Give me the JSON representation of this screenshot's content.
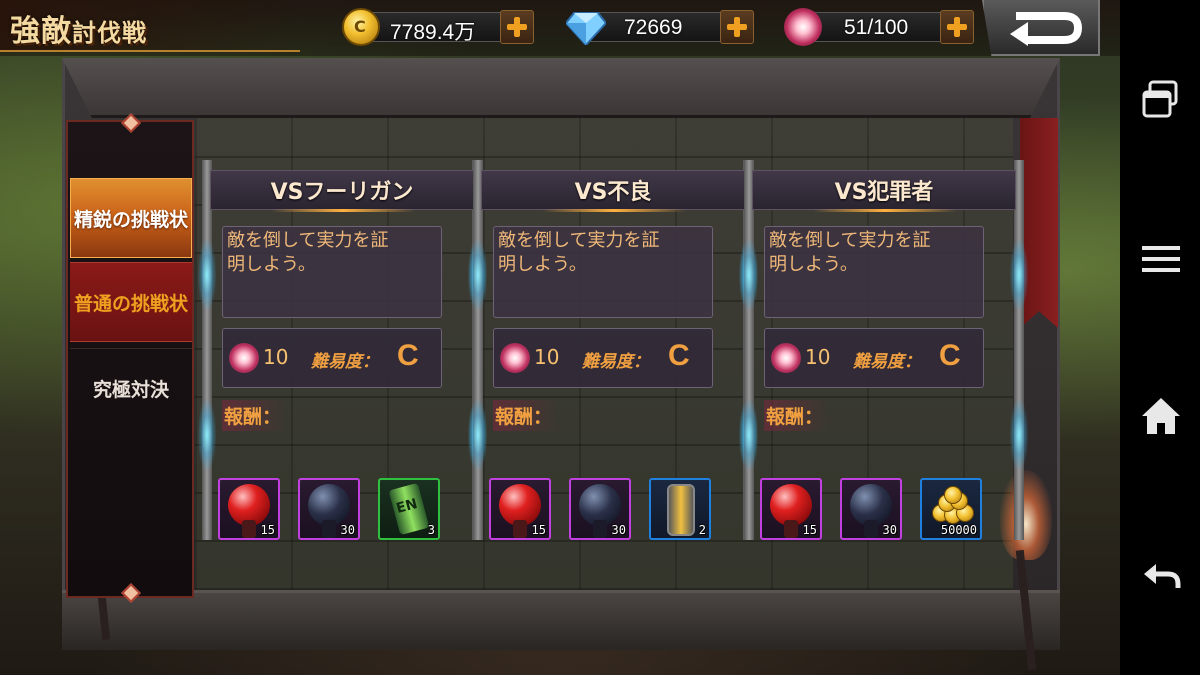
{
  "header": {
    "title_main": "強敵",
    "title_sub": "討伐戦"
  },
  "resources": {
    "coins": {
      "value": "7789.4万",
      "icon": "gold-coin-icon"
    },
    "gems": {
      "value": "72669",
      "icon": "diamond-icon"
    },
    "energy": {
      "value": "51/100",
      "icon": "energy-orb-icon"
    }
  },
  "tabs": [
    {
      "label": "精鋭の挑戦状",
      "state": "active"
    },
    {
      "label": "普通の挑戦状",
      "state": "normal"
    },
    {
      "label": "究極対決",
      "state": "normal"
    }
  ],
  "cards": [
    {
      "title": "VSフーリガン",
      "desc_line1": "敵を倒して実力を証",
      "desc_line2": "明しよう。",
      "cost": "10",
      "difficulty_label": "難易度：",
      "difficulty": "C",
      "reward_label": "報酬：",
      "rewards": [
        {
          "type": "red-orb",
          "qty": "15",
          "rarity": "purple"
        },
        {
          "type": "dark-orb",
          "qty": "30",
          "rarity": "purple"
        },
        {
          "type": "energy-drink",
          "qty": "3",
          "rarity": "green"
        }
      ]
    },
    {
      "title": "VS不良",
      "desc_line1": "敵を倒して実力を証",
      "desc_line2": "明しよう。",
      "cost": "10",
      "difficulty_label": "難易度：",
      "difficulty": "C",
      "reward_label": "報酬：",
      "rewards": [
        {
          "type": "red-orb",
          "qty": "15",
          "rarity": "purple"
        },
        {
          "type": "dark-orb",
          "qty": "30",
          "rarity": "purple"
        },
        {
          "type": "lantern",
          "qty": "2",
          "rarity": "blue"
        }
      ]
    },
    {
      "title": "VS犯罪者",
      "desc_line1": "敵を倒して実力を証",
      "desc_line2": "明しよう。",
      "cost": "10",
      "difficulty_label": "難易度：",
      "difficulty": "C",
      "reward_label": "報酬：",
      "rewards": [
        {
          "type": "red-orb",
          "qty": "15",
          "rarity": "purple"
        },
        {
          "type": "dark-orb",
          "qty": "30",
          "rarity": "purple"
        },
        {
          "type": "gold-coins",
          "qty": "50000",
          "rarity": "blue"
        }
      ]
    }
  ],
  "system_nav": [
    {
      "name": "recent-apps-icon"
    },
    {
      "name": "menu-icon"
    },
    {
      "name": "home-icon"
    },
    {
      "name": "back-arrow-icon"
    }
  ],
  "colors": {
    "accent_orange": "#f0a040",
    "tab_active": "#c86018",
    "tab_inactive_red": "#8a1a18",
    "rarity_purple": "#c040e0",
    "rarity_green": "#30c040",
    "rarity_blue": "#2080e0"
  }
}
